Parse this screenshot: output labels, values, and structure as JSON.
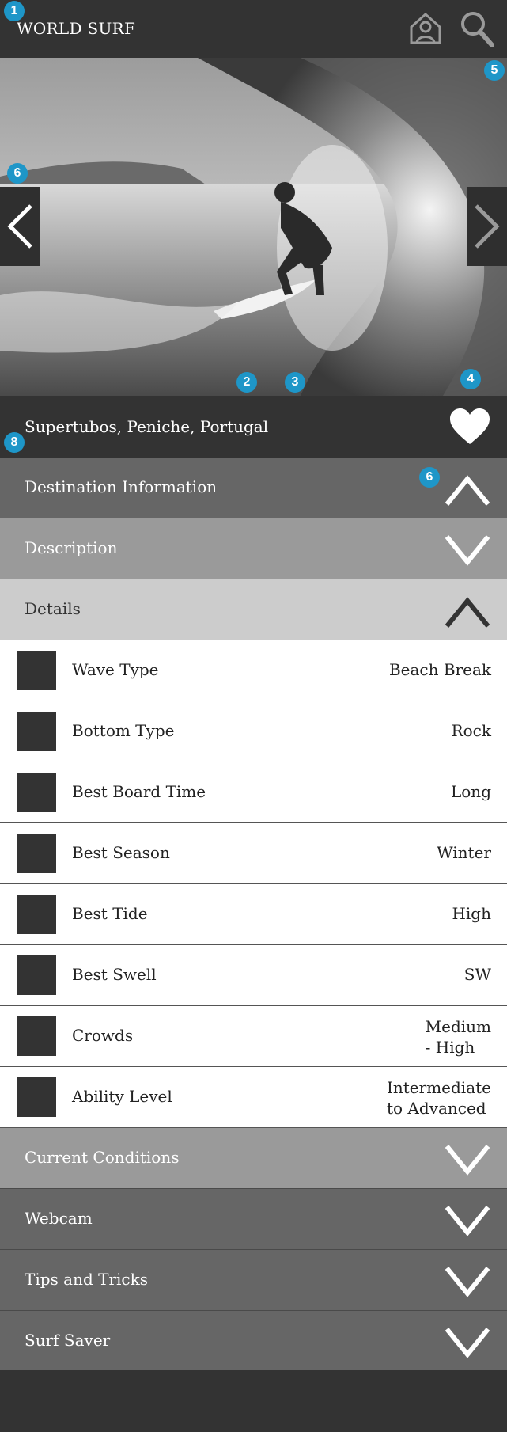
{
  "header": {
    "title": "WORLD SURF",
    "home_icon": "home-user-icon",
    "search_icon": "search-icon"
  },
  "badges": {
    "b1": "1",
    "b2": "2",
    "b3": "3",
    "b4": "4",
    "b5": "5",
    "b6a": "6",
    "b6b": "6",
    "b8": "8"
  },
  "hero": {
    "prev_icon": "chevron-left-icon",
    "next_icon": "chevron-right-icon"
  },
  "location": {
    "name": "Supertubos, Peniche, Portugal",
    "favorite_icon": "heart-icon"
  },
  "sections": {
    "destination": "Destination Information",
    "description": "Description",
    "details": "Details",
    "current": "Current Conditions",
    "webcam": "Webcam",
    "tips": "Tips and Tricks",
    "saver": "Surf Saver"
  },
  "details": [
    {
      "label": "Wave Type",
      "value": "Beach Break"
    },
    {
      "label": "Bottom Type",
      "value": "Rock"
    },
    {
      "label": "Best Board Time",
      "value": "Long"
    },
    {
      "label": "Best Season",
      "value": "Winter"
    },
    {
      "label": "Best Tide",
      "value": "High"
    },
    {
      "label": "Best Swell",
      "value": "SW"
    },
    {
      "label": "Crowds",
      "value1": "Medium",
      "value2": "- High"
    },
    {
      "label": "Ability Level",
      "value1": "Intermediate",
      "value2": "to Advanced"
    }
  ],
  "colors": {
    "dark": "#333333",
    "accent": "#1e96c8",
    "section_dark": "#666666",
    "section_mid": "#9a9a9a",
    "section_light": "#cccccc"
  }
}
